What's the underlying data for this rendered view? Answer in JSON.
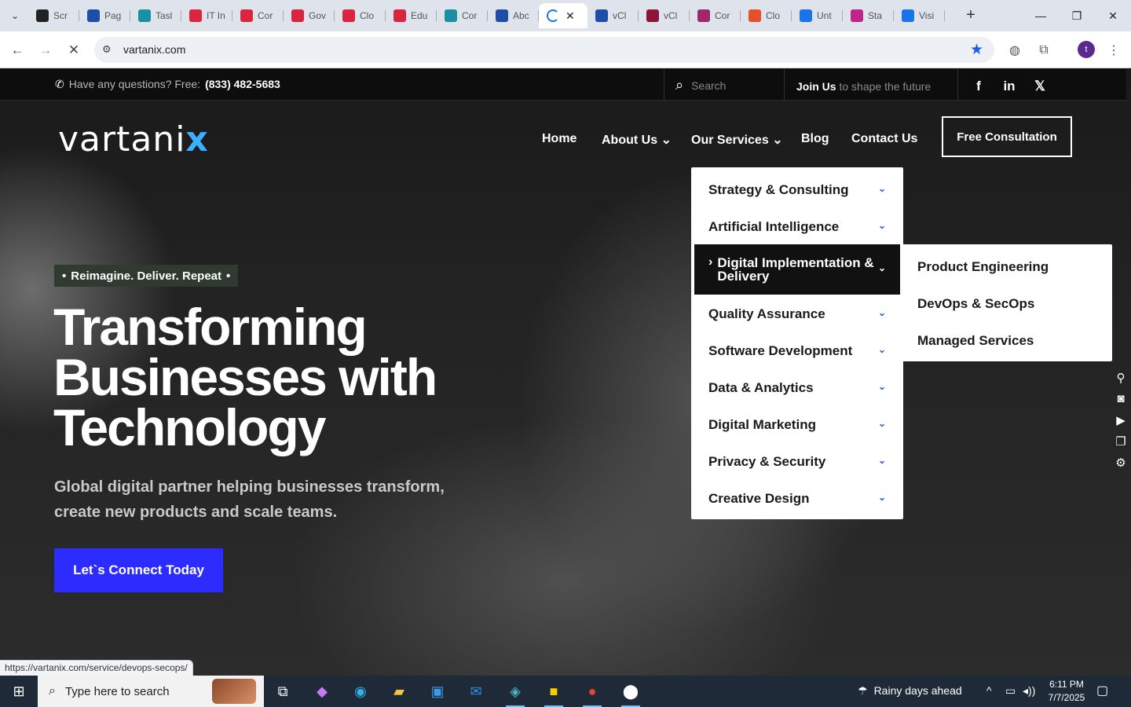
{
  "browser": {
    "tabs": [
      {
        "label": "Scr",
        "color": "#222222"
      },
      {
        "label": "Pag",
        "color": "#1e4fa8"
      },
      {
        "label": "Tasl",
        "color": "#1b8fa3"
      },
      {
        "label": "IT In",
        "color": "#d7263d"
      },
      {
        "label": "Cor",
        "color": "#d7263d"
      },
      {
        "label": "Gov",
        "color": "#d7263d"
      },
      {
        "label": "Clo",
        "color": "#d7263d"
      },
      {
        "label": "Edu",
        "color": "#d7263d"
      },
      {
        "label": "Cor",
        "color": "#1b8fa3"
      },
      {
        "label": "Abc",
        "color": "#1e4fa8"
      }
    ],
    "tabs_after": [
      {
        "label": "vCl",
        "color": "#1e4fa8"
      },
      {
        "label": "vCl",
        "color": "#8a1538"
      },
      {
        "label": "Cor",
        "color": "#a0286a"
      },
      {
        "label": "Clo",
        "color": "#e2512b"
      },
      {
        "label": "Unt",
        "color": "#1a73e8"
      },
      {
        "label": "Sta",
        "color": "#c0248a"
      },
      {
        "label": "Visi",
        "color": "#1a73e8"
      }
    ],
    "url": "vartanix.com",
    "profile_initial": "t",
    "status_url": "https://vartanix.com/service/devops-secops/"
  },
  "topbar": {
    "question": "Have any questions? Free:",
    "phone": "(833) 482-5683",
    "search_placeholder": "Search",
    "join_bold": "Join Us",
    "join_rest": " to shape the future"
  },
  "logo": {
    "text": "vartani",
    "x": "x"
  },
  "nav": {
    "home": "Home",
    "about": "About Us",
    "services": "Our Services",
    "blog": "Blog",
    "contact": "Contact Us",
    "cta": "Free Consultation"
  },
  "hero": {
    "badge": "Reimagine. Deliver. Repeat",
    "title_1": "Transforming",
    "title_2": "Businesses with",
    "title_3": "Technology",
    "subtitle": "Global digital partner helping businesses transform, create new products and scale teams.",
    "button": "Let`s Connect Today"
  },
  "services_menu": {
    "items": [
      "Strategy & Consulting",
      "Artificial Intelligence",
      "Digital Implementation & Delivery",
      "Quality Assurance",
      "Software Development",
      "Data & Analytics",
      "Digital Marketing",
      "Privacy & Security",
      "Creative Design"
    ],
    "submenu": [
      "Product Engineering",
      "DevOps & SecOps",
      "Managed Services"
    ]
  },
  "taskbar": {
    "search_placeholder": "Type here to search",
    "weather": "Rainy days ahead",
    "time": "6:11 PM",
    "date": "7/7/2025"
  }
}
